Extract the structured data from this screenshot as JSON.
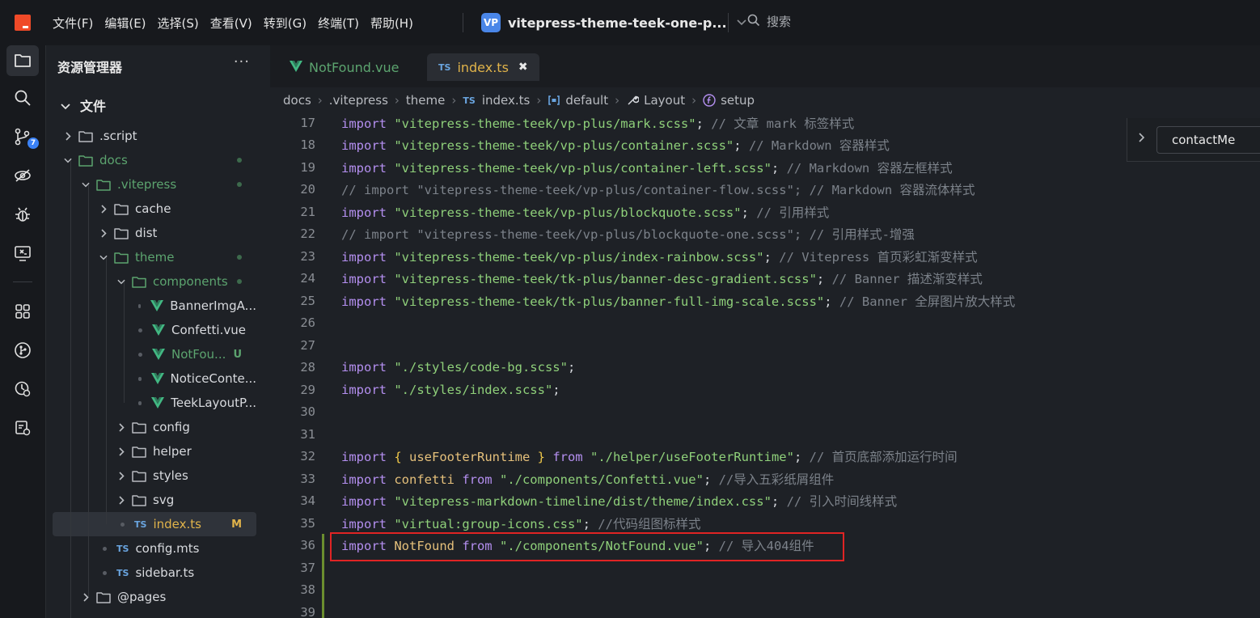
{
  "menu": [
    "文件(F)",
    "编辑(E)",
    "选择(S)",
    "查看(V)",
    "转到(G)",
    "终端(T)",
    "帮助(H)"
  ],
  "project": {
    "badge": "VP",
    "name": "vitepress-theme-teek-one-p..."
  },
  "search": {
    "label": "搜索"
  },
  "activity": {
    "scm_badge": "7"
  },
  "sidebar": {
    "title": "资源管理器",
    "more": "···",
    "section": "文件",
    "tree": [
      {
        "label": ".script",
        "type": "folder",
        "level": 0,
        "open": false
      },
      {
        "label": "docs",
        "type": "folder",
        "level": 0,
        "open": true,
        "color": "green",
        "dot": true
      },
      {
        "label": ".vitepress",
        "type": "folder",
        "level": 1,
        "open": true,
        "color": "green",
        "dot": true
      },
      {
        "label": "cache",
        "type": "folder",
        "level": 2,
        "open": false
      },
      {
        "label": "dist",
        "type": "folder",
        "level": 2,
        "open": false
      },
      {
        "label": "theme",
        "type": "folder",
        "level": 2,
        "open": true,
        "color": "green",
        "dot": true
      },
      {
        "label": "components",
        "type": "folder",
        "level": 3,
        "open": true,
        "color": "green",
        "dot": true
      },
      {
        "label": "BannerImgA...",
        "type": "vue",
        "level": 4
      },
      {
        "label": "Confetti.vue",
        "type": "vue",
        "level": 4
      },
      {
        "label": "NotFou...",
        "type": "vue",
        "level": 4,
        "color": "green",
        "status": "U"
      },
      {
        "label": "NoticeConte...",
        "type": "vue",
        "level": 4
      },
      {
        "label": "TeekLayoutP...",
        "type": "vue",
        "level": 4
      },
      {
        "label": "config",
        "type": "folder",
        "level": 3,
        "open": false
      },
      {
        "label": "helper",
        "type": "folder",
        "level": 3,
        "open": false
      },
      {
        "label": "styles",
        "type": "folder",
        "level": 3,
        "open": false
      },
      {
        "label": "svg",
        "type": "folder",
        "level": 3,
        "open": false
      },
      {
        "label": "index.ts",
        "type": "ts",
        "level": 3,
        "color": "yellow",
        "status": "M",
        "selected": true
      },
      {
        "label": "config.mts",
        "type": "ts",
        "level": 2
      },
      {
        "label": "sidebar.ts",
        "type": "ts",
        "level": 2
      },
      {
        "label": "@pages",
        "type": "folder",
        "level": 1,
        "open": false
      }
    ]
  },
  "tabs": [
    {
      "label": "NotFound.vue",
      "type": "vue",
      "active": false
    },
    {
      "label": "index.ts",
      "type": "ts",
      "active": true,
      "close": "✖"
    }
  ],
  "breadcrumb": [
    "docs",
    ".vitepress",
    "theme",
    "index.ts",
    "default",
    "Layout",
    "setup"
  ],
  "ts_tag": "TS",
  "outline": {
    "label": "contactMe"
  },
  "code": [
    {
      "n": "17",
      "t": [
        [
          "kw",
          "import "
        ],
        [
          "str",
          "\"vitepress-theme-teek/vp-plus/mark.scss\""
        ],
        [
          "pl",
          "; "
        ],
        [
          "cm",
          "// 文章 mark 标签样式"
        ]
      ]
    },
    {
      "n": "18",
      "t": [
        [
          "kw",
          "import "
        ],
        [
          "str",
          "\"vitepress-theme-teek/vp-plus/container.scss\""
        ],
        [
          "pl",
          "; "
        ],
        [
          "cm",
          "// Markdown 容器样式"
        ]
      ]
    },
    {
      "n": "19",
      "t": [
        [
          "kw",
          "import "
        ],
        [
          "str",
          "\"vitepress-theme-teek/vp-plus/container-left.scss\""
        ],
        [
          "pl",
          "; "
        ],
        [
          "cm",
          "// Markdown 容器左框样式"
        ]
      ]
    },
    {
      "n": "20",
      "t": [
        [
          "cm",
          "// import \"vitepress-theme-teek/vp-plus/container-flow.scss\"; // Markdown 容器流体样式"
        ]
      ]
    },
    {
      "n": "21",
      "t": [
        [
          "kw",
          "import "
        ],
        [
          "str",
          "\"vitepress-theme-teek/vp-plus/blockquote.scss\""
        ],
        [
          "pl",
          "; "
        ],
        [
          "cm",
          "// 引用样式"
        ]
      ]
    },
    {
      "n": "22",
      "t": [
        [
          "cm",
          "// import \"vitepress-theme-teek/vp-plus/blockquote-one.scss\"; // 引用样式-增强"
        ]
      ]
    },
    {
      "n": "23",
      "t": [
        [
          "kw",
          "import "
        ],
        [
          "str",
          "\"vitepress-theme-teek/vp-plus/index-rainbow.scss\""
        ],
        [
          "pl",
          "; "
        ],
        [
          "cm",
          "// Vitepress 首页彩虹渐变样式"
        ]
      ]
    },
    {
      "n": "24",
      "t": [
        [
          "kw",
          "import "
        ],
        [
          "str",
          "\"vitepress-theme-teek/tk-plus/banner-desc-gradient.scss\""
        ],
        [
          "pl",
          "; "
        ],
        [
          "cm",
          "// Banner 描述渐变样式"
        ]
      ]
    },
    {
      "n": "25",
      "t": [
        [
          "kw",
          "import "
        ],
        [
          "str",
          "\"vitepress-theme-teek/tk-plus/banner-full-img-scale.scss\""
        ],
        [
          "pl",
          "; "
        ],
        [
          "cm",
          "// Banner 全屏图片放大样式"
        ]
      ]
    },
    {
      "n": "26",
      "t": []
    },
    {
      "n": "27",
      "t": []
    },
    {
      "n": "28",
      "t": [
        [
          "kw",
          "import "
        ],
        [
          "str",
          "\"./styles/code-bg.scss\""
        ],
        [
          "pl",
          ";"
        ]
      ]
    },
    {
      "n": "29",
      "t": [
        [
          "kw",
          "import "
        ],
        [
          "str",
          "\"./styles/index.scss\""
        ],
        [
          "pl",
          ";"
        ]
      ]
    },
    {
      "n": "30",
      "t": []
    },
    {
      "n": "31",
      "t": []
    },
    {
      "n": "32",
      "t": [
        [
          "kw",
          "import "
        ],
        [
          "br",
          "{ "
        ],
        [
          "idn",
          "useFooterRuntime"
        ],
        [
          "br",
          " }"
        ],
        [
          "kw",
          " from "
        ],
        [
          "str",
          "\"./helper/useFooterRuntime\""
        ],
        [
          "pl",
          "; "
        ],
        [
          "cm",
          "// 首页底部添加运行时间"
        ]
      ]
    },
    {
      "n": "33",
      "t": [
        [
          "kw",
          "import "
        ],
        [
          "idn",
          "confetti"
        ],
        [
          "kw",
          " from "
        ],
        [
          "str",
          "\"./components/Confetti.vue\""
        ],
        [
          "pl",
          "; "
        ],
        [
          "cm",
          "//导入五彩纸屑组件"
        ]
      ]
    },
    {
      "n": "34",
      "t": [
        [
          "kw",
          "import "
        ],
        [
          "str",
          "\"vitepress-markdown-timeline/dist/theme/index.css\""
        ],
        [
          "pl",
          "; "
        ],
        [
          "cm",
          "// 引入时间线样式"
        ]
      ]
    },
    {
      "n": "35",
      "t": [
        [
          "kw",
          "import "
        ],
        [
          "str",
          "\"virtual:group-icons.css\""
        ],
        [
          "pl",
          "; "
        ],
        [
          "cm",
          "//代码组图标样式"
        ]
      ]
    },
    {
      "n": "36",
      "t": [
        [
          "kw",
          "import "
        ],
        [
          "idn",
          "NotFound"
        ],
        [
          "kw",
          " from "
        ],
        [
          "str",
          "\"./components/NotFound.vue\""
        ],
        [
          "pl",
          "; "
        ],
        [
          "cm",
          "// 导入404组件"
        ]
      ]
    },
    {
      "n": "37",
      "t": []
    },
    {
      "n": "38",
      "t": []
    },
    {
      "n": "39",
      "t": []
    }
  ],
  "colors": {
    "accent": "#3b82f6",
    "highlight_box": "#e02424",
    "vue_green": "#42b883",
    "logo": "#f04a28"
  }
}
